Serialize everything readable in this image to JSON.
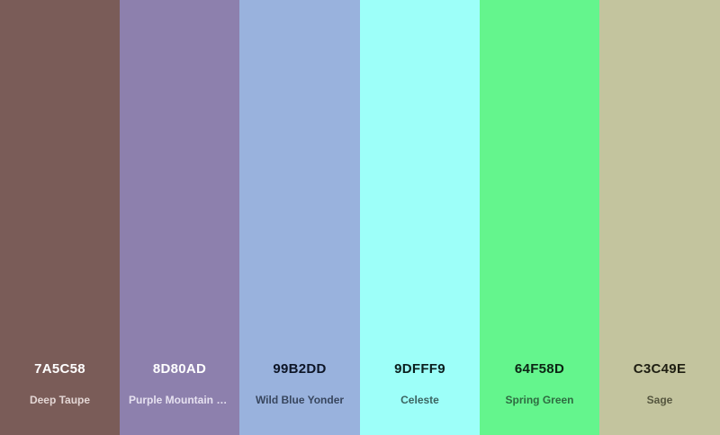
{
  "palette": {
    "colors": [
      {
        "hex": "7A5C58",
        "name": "Deep Taupe",
        "bg": "#7A5C58",
        "hex_color": "#FFFFFF",
        "name_color": "#E3D6D4"
      },
      {
        "hex": "8D80AD",
        "name": "Purple Mountain Majesty",
        "bg": "#8D80AD",
        "hex_color": "#FFFFFF",
        "name_color": "#E6E1F0"
      },
      {
        "hex": "99B2DD",
        "name": "Wild Blue Yonder",
        "bg": "#99B2DD",
        "hex_color": "#0D1526",
        "name_color": "#38465E"
      },
      {
        "hex": "9DFFF9",
        "name": "Celeste",
        "bg": "#9DFFF9",
        "hex_color": "#0B1F1E",
        "name_color": "#3B6461"
      },
      {
        "hex": "64F58D",
        "name": "Spring Green",
        "bg": "#64F58D",
        "hex_color": "#0C2414",
        "name_color": "#2F6B41"
      },
      {
        "hex": "C3C49E",
        "name": "Sage",
        "bg": "#C3C49E",
        "hex_color": "#1E1E12",
        "name_color": "#55563F"
      }
    ]
  }
}
